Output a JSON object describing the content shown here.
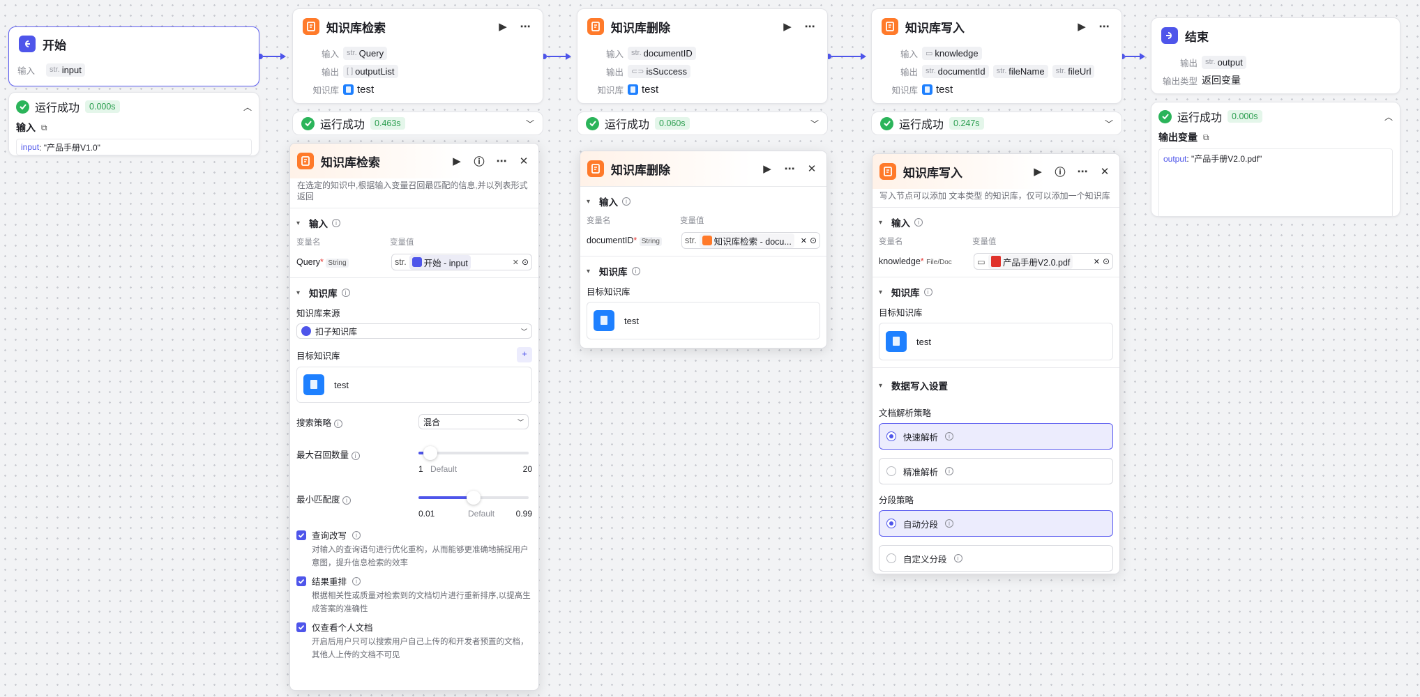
{
  "start": {
    "title": "开始",
    "input_label": "输入",
    "input_type": "str.",
    "input_name": "input",
    "status": "运行成功",
    "time": "0.000s",
    "io_label": "输入",
    "val_key": "input",
    "val": ": \"产品手册V1.0\""
  },
  "search": {
    "title": "知识库检索",
    "in_label": "输入",
    "in_type": "str.",
    "in_name": "Query",
    "out_label": "输出",
    "out_type": "[ ]",
    "out_name": "outputList",
    "kb_label": "知识库",
    "kb_name": "test",
    "status": "运行成功",
    "time": "0.463s"
  },
  "delete": {
    "title": "知识库删除",
    "in_label": "输入",
    "in_type": "str.",
    "in_name": "documentID",
    "out_label": "输出",
    "out_name": "isSuccess",
    "kb_label": "知识库",
    "kb_name": "test",
    "status": "运行成功",
    "time": "0.060s"
  },
  "write": {
    "title": "知识库写入",
    "in_label": "输入",
    "in_name": "knowledge",
    "out_label": "输出",
    "out_type": "str.",
    "out1": "documentId",
    "out2": "fileName",
    "out3": "fileUrl",
    "kb_label": "知识库",
    "kb_name": "test",
    "status": "运行成功",
    "time": "0.247s"
  },
  "end": {
    "title": "结束",
    "out_label": "输出",
    "out_type": "str.",
    "out_name": "output",
    "ret_label": "输出类型",
    "ret_val": "返回变量",
    "status": "运行成功",
    "time": "0.000s",
    "io_label": "输出变量",
    "val_key": "output",
    "val": ": \"产品手册V2.0.pdf\""
  },
  "p_search": {
    "title": "知识库检索",
    "desc": "在选定的知识中,根据输入变量召回最匹配的信息,并以列表形式返回",
    "input_hd": "输入",
    "col_name": "变量名",
    "col_val": "变量值",
    "var": "Query",
    "var_type": "String",
    "val_prefix": "str.",
    "val_chip": "开始 - input",
    "kb_hd": "知识库",
    "src_label": "知识库来源",
    "src_val": "扣子知识库",
    "target_label": "目标知识库",
    "target_name": "test",
    "strategy_label": "搜索策略",
    "strategy_val": "混合",
    "max_label": "最大召回数量",
    "max_min": "1",
    "max_default": "Default",
    "max_max": "20",
    "max_value": 3,
    "max_range": [
      1,
      20
    ],
    "min_label": "最小匹配度",
    "min_min": "0.01",
    "min_default": "Default",
    "min_max": "0.99",
    "min_value": 0.5,
    "min_range": [
      0.01,
      0.99
    ],
    "cb1_label": "查询改写",
    "cb1_desc": "对输入的查询语句进行优化重构，从而能够更准确地捕捉用户意图，提升信息检索的效率",
    "cb2_label": "结果重排",
    "cb2_desc": "根据相关性或质量对检索到的文档切片进行重新排序,以提高生成答案的准确性",
    "cb3_label": "仅查看个人文档",
    "cb3_desc": "开启后用户只可以搜索用户自己上传的和开发者预置的文档，其他人上传的文档不可见"
  },
  "p_delete": {
    "title": "知识库删除",
    "input_hd": "输入",
    "col_name": "变量名",
    "col_val": "变量值",
    "var": "documentID",
    "var_type": "String",
    "val_prefix": "str.",
    "val_chip": "知识库检索 - docu...",
    "kb_hd": "知识库",
    "target_label": "目标知识库",
    "target_name": "test"
  },
  "p_write": {
    "title": "知识库写入",
    "desc": "写入节点可以添加 文本类型 的知识库，仅可以添加一个知识库",
    "input_hd": "输入",
    "col_name": "变量名",
    "col_val": "变量值",
    "var": "knowledge",
    "var_type": "File/Doc",
    "val_chip": "产品手册V2.0.pdf",
    "kb_hd": "知识库",
    "target_label": "目标知识库",
    "target_name": "test",
    "settings_hd": "数据写入设置",
    "parse_label": "文档解析策略",
    "parse_fast": "快速解析",
    "parse_precise": "精准解析",
    "seg_label": "分段策略",
    "seg_auto": "自动分段",
    "seg_custom": "自定义分段"
  },
  "icons": {
    "play": "play-icon",
    "more": "more-icon",
    "help": "help-icon",
    "close": "close-icon"
  },
  "colors": {
    "accent": "#4e55ea",
    "node_orange": "#ff7a2a",
    "success": "#2bb45a"
  }
}
